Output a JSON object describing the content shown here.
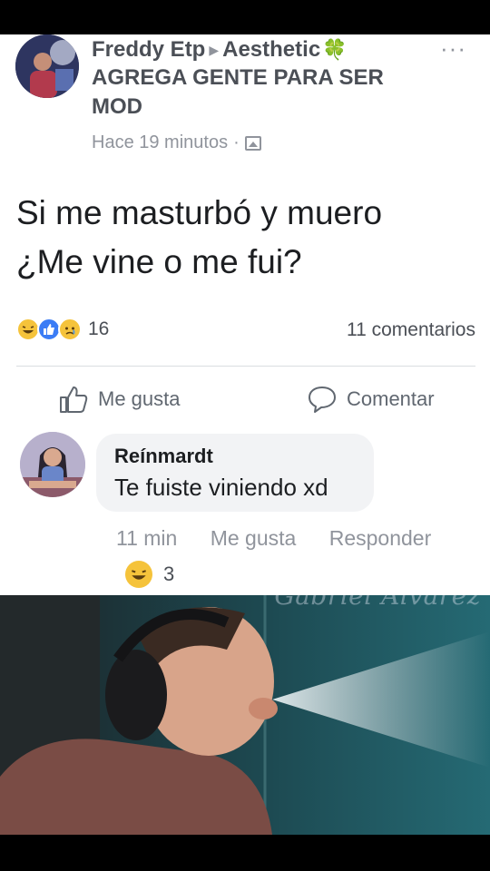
{
  "post": {
    "author": "Freddy Etp",
    "group": "Aesthetic",
    "group_emoji": "🍀",
    "group_note": "AGREGA GENTE PARA SER MOD",
    "timestamp": "Hace 19 minutos",
    "separator": "·",
    "more": "···",
    "text_line1": "Si me masturbó y muero",
    "text_line2": "¿Me vine o me fui?",
    "reaction_count": "16",
    "comment_count": "11 comentarios"
  },
  "actions": {
    "like_label": "Me gusta",
    "comment_label": "Comentar"
  },
  "comment": {
    "author": "Reínmardt",
    "text": "Te fuiste viniendo xd",
    "time": "11 min",
    "like_label": "Me gusta",
    "reply_label": "Responder",
    "reaction_count": "3"
  },
  "watermark": "Gabriel Alvarez",
  "colors": {
    "card_bg": "#ffffff",
    "secondary_text": "#90949c",
    "bubble_bg": "#f2f3f5",
    "like_blue": "#3b7cf5",
    "haha_yellow": "#f5c33b"
  }
}
